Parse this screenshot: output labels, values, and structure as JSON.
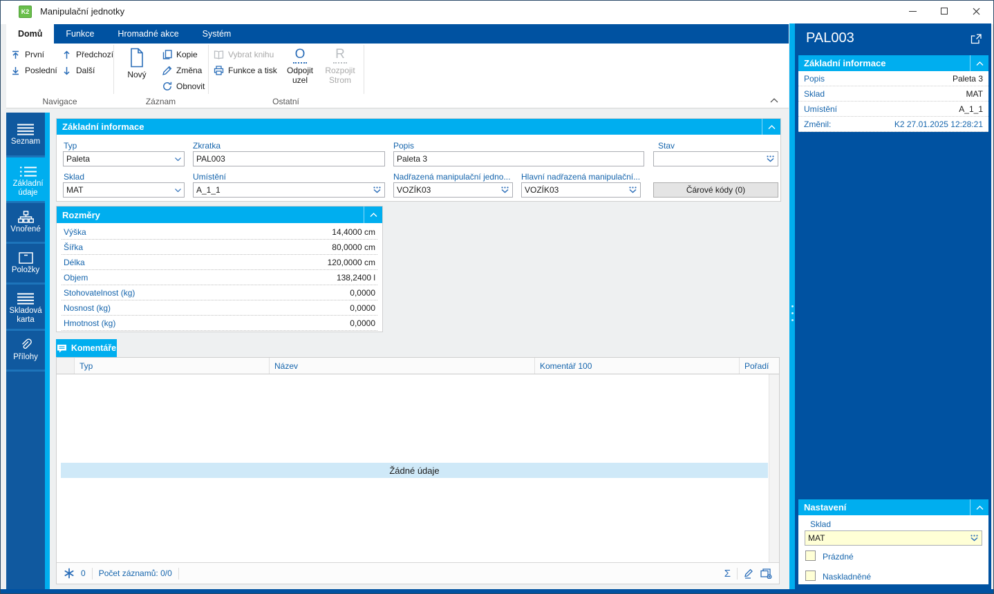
{
  "colors": {
    "accent_dark": "#0052a1",
    "accent_cyan": "#00aeef",
    "label_blue": "#1464ac",
    "icon_blue": "#2a6db8",
    "cream_input": "#ffffd6",
    "empty_row": "#cfe9f8"
  },
  "window": {
    "title": "Manipulační jednotky",
    "logo_text": "K2"
  },
  "ribbon": {
    "tabs": [
      {
        "label": "Domů"
      },
      {
        "label": "Funkce"
      },
      {
        "label": "Hromadné akce"
      },
      {
        "label": "Systém"
      }
    ],
    "navigace": {
      "label": "Navigace",
      "first": "První",
      "last": "Poslední",
      "prev": "Předchozí",
      "next": "Další"
    },
    "zaznam": {
      "label": "Záznam",
      "new": "Nový",
      "copy": "Kopie",
      "change": "Změna",
      "refresh": "Obnovit"
    },
    "ostatni": {
      "label": "Ostatní",
      "select_book": "Vybrat knihu",
      "func_print": "Funkce a tisk",
      "disconnect_glyph": "O",
      "disconnect_line1": "Odpojit",
      "disconnect_line2": "uzel",
      "split_glyph": "R",
      "split_line1": "Rozpojit",
      "split_line2": "Strom"
    }
  },
  "sidebar": {
    "items": [
      {
        "label": "Seznam",
        "icon": "menu-icon"
      },
      {
        "label": "Základní údaje",
        "icon": "list-icon"
      },
      {
        "label": "Vnořené",
        "icon": "tree-icon"
      },
      {
        "label": "Položky",
        "icon": "box-icon"
      },
      {
        "label": "Skladová karta",
        "icon": "menu-icon"
      },
      {
        "label": "Přílohy",
        "icon": "paperclip-icon"
      }
    ]
  },
  "basic": {
    "title": "Základní informace",
    "typ": {
      "label": "Typ",
      "value": "Paleta"
    },
    "zkratka": {
      "label": "Zkratka",
      "value": "PAL003"
    },
    "popis": {
      "label": "Popis",
      "value": "Paleta 3"
    },
    "stav": {
      "label": "Stav",
      "value": ""
    },
    "sklad": {
      "label": "Sklad",
      "value": "MAT"
    },
    "umisteni": {
      "label": "Umístění",
      "value": "A_1_1"
    },
    "nadrazena": {
      "label": "Nadřazená manipulační jedno...",
      "value": "VOZÍK03"
    },
    "hlavni": {
      "label": "Hlavní nadřazená manipulační...",
      "value": "VOZÍK03"
    },
    "barcodes_button": "Čárové kódy (0)"
  },
  "dimensions": {
    "title": "Rozměry",
    "rows": [
      {
        "label": "Výška",
        "value": "14,4000 cm"
      },
      {
        "label": "Šířka",
        "value": "80,0000 cm"
      },
      {
        "label": "Délka",
        "value": "120,0000 cm"
      },
      {
        "label": "Objem",
        "value": "138,2400 l"
      },
      {
        "label": "Stohovatelnost (kg)",
        "value": "0,0000"
      },
      {
        "label": "Nosnost (kg)",
        "value": "0,0000"
      },
      {
        "label": "Hmotnost (kg)",
        "value": "0,0000"
      }
    ]
  },
  "comments": {
    "tab_label": "Komentáře",
    "columns": [
      "Typ",
      "Název",
      "Komentář 100",
      "Pořadí"
    ],
    "empty_text": "Žádné údaje",
    "status_count": "0",
    "status_records": "Počet záznamů: 0/0",
    "sum_symbol": "Σ"
  },
  "right_panel": {
    "title": "PAL003",
    "info": {
      "title": "Základní informace",
      "rows": [
        {
          "label": "Popis",
          "value": "Paleta 3"
        },
        {
          "label": "Sklad",
          "value": "MAT"
        },
        {
          "label": "Umístění",
          "value": "A_1_1"
        },
        {
          "label": "Změnil:",
          "value": "K2 27.01.2025 12:28:21"
        }
      ]
    },
    "settings": {
      "title": "Nastavení",
      "sklad_label": "Sklad",
      "sklad_value": "MAT",
      "checkbox1": "Prázdné",
      "checkbox2": "Naskladněné"
    }
  }
}
